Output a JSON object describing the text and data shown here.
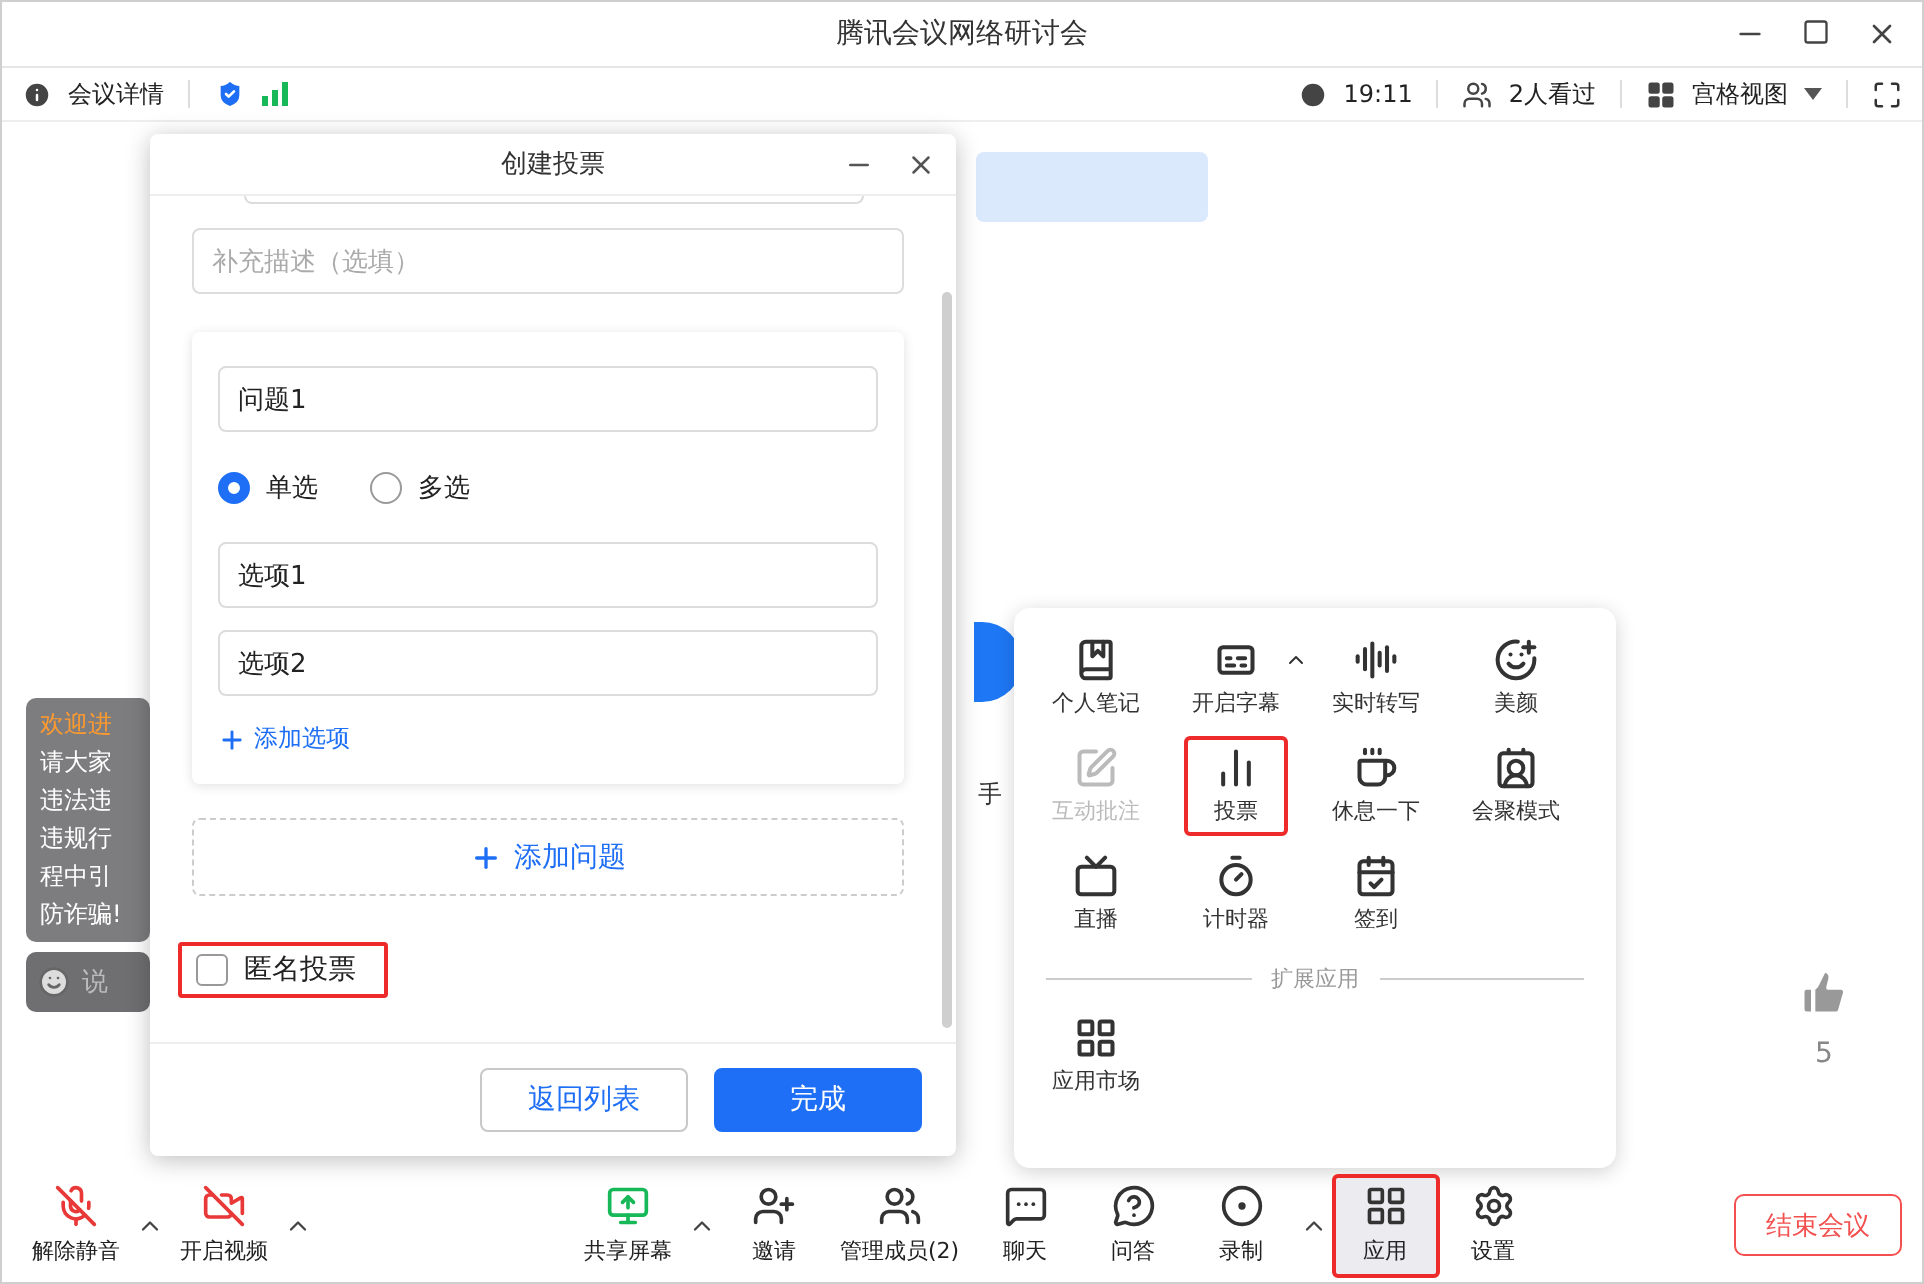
{
  "window": {
    "title": "腾讯会议网络研讨会"
  },
  "info_bar": {
    "details": "会议详情",
    "time": "19:11",
    "viewers": "2人看过",
    "view_mode": "宫格视图"
  },
  "stage": {
    "speaker_label": "手",
    "likes": "5"
  },
  "chat": {
    "messages": [
      {
        "text": "欢迎进",
        "kind": "notice"
      },
      {
        "text": "请大家",
        "kind": "plain"
      },
      {
        "text": "违法违",
        "kind": "plain"
      },
      {
        "text": "违规行",
        "kind": "plain"
      },
      {
        "text": "程中引",
        "kind": "plain"
      },
      {
        "text": "防诈骗!",
        "kind": "plain"
      }
    ],
    "input_placeholder": "说"
  },
  "poll_dialog": {
    "title": "创建投票",
    "description_placeholder": "补充描述（选填）",
    "question": {
      "title": "问题1",
      "modes": [
        {
          "label": "单选",
          "selected": true
        },
        {
          "label": "多选",
          "selected": false
        }
      ],
      "options": [
        "选项1",
        "选项2"
      ],
      "add_option": "添加选项"
    },
    "add_question": "添加问题",
    "anonymous": {
      "label": "匿名投票",
      "checked": false,
      "highlighted": true
    },
    "buttons": [
      {
        "label": "返回列表",
        "kind": "secondary"
      },
      {
        "label": "完成",
        "kind": "primary"
      }
    ]
  },
  "apps_menu": {
    "items": [
      {
        "label": "个人笔记",
        "kind": "notebook",
        "disabled": false,
        "highlighted": false,
        "has_menu": false
      },
      {
        "label": "开启字幕",
        "kind": "captions",
        "disabled": false,
        "highlighted": false,
        "has_menu": true
      },
      {
        "label": "实时转写",
        "kind": "transcribe",
        "disabled": false,
        "highlighted": false,
        "has_menu": false
      },
      {
        "label": "美颜",
        "kind": "beauty",
        "disabled": false,
        "highlighted": false,
        "has_menu": false
      },
      {
        "label": "互动批注",
        "kind": "annotate",
        "disabled": true,
        "highlighted": false,
        "has_menu": false
      },
      {
        "label": "投票",
        "kind": "poll",
        "disabled": false,
        "highlighted": true,
        "has_menu": false
      },
      {
        "label": "休息一下",
        "kind": "coffee",
        "disabled": false,
        "highlighted": false,
        "has_menu": false
      },
      {
        "label": "会聚模式",
        "kind": "together",
        "disabled": false,
        "highlighted": false,
        "has_menu": false
      },
      {
        "label": "直播",
        "kind": "live",
        "disabled": false,
        "highlighted": false,
        "has_menu": false
      },
      {
        "label": "计时器",
        "kind": "timer",
        "disabled": false,
        "highlighted": false,
        "has_menu": false
      },
      {
        "label": "签到",
        "kind": "checkin",
        "disabled": false,
        "highlighted": false,
        "has_menu": false
      }
    ],
    "section": "扩展应用",
    "extensions": [
      {
        "label": "应用市场",
        "kind": "grid"
      }
    ]
  },
  "toolbar": {
    "left": [
      {
        "label": "解除静音",
        "kind": "mic",
        "has_menu": true,
        "selected": false
      },
      {
        "label": "开启视频",
        "kind": "video",
        "has_menu": true,
        "selected": false
      }
    ],
    "center": [
      {
        "label": "共享屏幕",
        "kind": "share",
        "has_menu": true,
        "selected": false
      },
      {
        "label": "邀请",
        "kind": "invite",
        "has_menu": false,
        "selected": false
      },
      {
        "label": "管理成员(2)",
        "kind": "members",
        "has_menu": false,
        "selected": false
      },
      {
        "label": "聊天",
        "kind": "chat",
        "has_menu": false,
        "selected": false
      },
      {
        "label": "问答",
        "kind": "qa",
        "has_menu": false,
        "selected": false
      },
      {
        "label": "录制",
        "kind": "record",
        "has_menu": true,
        "selected": false
      },
      {
        "label": "应用",
        "kind": "apps",
        "has_menu": false,
        "selected": true
      },
      {
        "label": "设置",
        "kind": "settings",
        "has_menu": false,
        "selected": false
      }
    ],
    "end_button": "结束会议"
  }
}
